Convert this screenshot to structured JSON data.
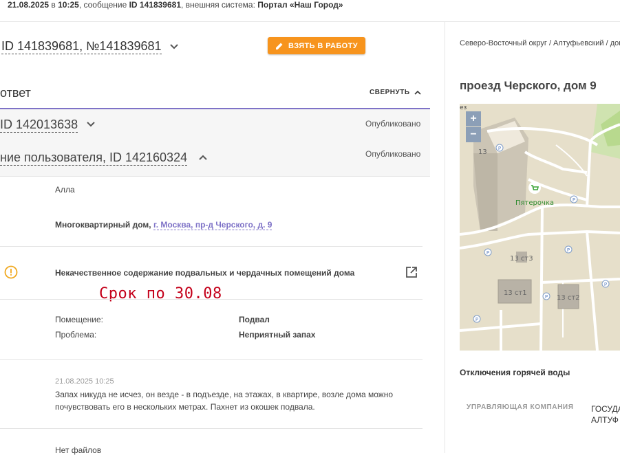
{
  "topbar": {
    "date": "21.08.2025",
    "in_word": " в ",
    "time": "10:25",
    "msg_prefix": ", сообщение ",
    "msg_id": "ID 141839681",
    "ext_prefix": ", внешняя система: ",
    "ext_system": "Портал «Наш Город»"
  },
  "message": {
    "title": "ID 141839681, №141839681",
    "take_button": "ВЗЯТЬ В РАБОТУ",
    "answer_label": "ответ",
    "collapse_label": "СВЕРНУТЬ"
  },
  "rows": [
    {
      "id_text": "ID 142013638",
      "status": "Опубликовано"
    },
    {
      "id_text": "ние пользователя, ID 142160324",
      "status": "Опубликовано"
    }
  ],
  "details": {
    "user_name": "Алла",
    "object_type": "Многоквартирный дом, ",
    "object_address": "г. Москва, пр-д Черского, д. 9",
    "issue_title": "Некачественное содержание подвальных и чердачных помещений дома",
    "deadline": "Срок по 30.08",
    "room_label": "Помещение:",
    "room_value": "Подвал",
    "problem_label": "Проблема:",
    "problem_value": "Неприятный запах",
    "comment_date": "21.08.2025 10:25",
    "comment_text": "Запах никуда не исчез, он везде - в подъезде, на этажах, в квартире, возле дома можно почувствовать его в нескольких метрах. Пахнет из окошек подвала.",
    "files": "Нет файлов"
  },
  "side": {
    "breadcrumb": "Северо-Восточный округ / Алтуфьевский / дом",
    "address": "проезд Черского, дом 9",
    "outage_title": "Отключения горячей воды",
    "uk_label": "УПРАВЛЯЮЩАЯ КОМПАНИЯ",
    "gosud_line1": "ГОСУДА",
    "gosud_line2": "АЛТУФ"
  },
  "map": {
    "zoom_in": "+",
    "zoom_out": "−",
    "poi": "Пятерочка",
    "b13": "13",
    "b13s3": "13 ст3",
    "b13s1": "13 ст1",
    "b13s2": "13 ст2",
    "corner": "ез"
  },
  "colors": {
    "accent": "#7e72c7",
    "orange": "#f7941d",
    "deadline": "#c4001a",
    "warning": "#f0a81e"
  }
}
